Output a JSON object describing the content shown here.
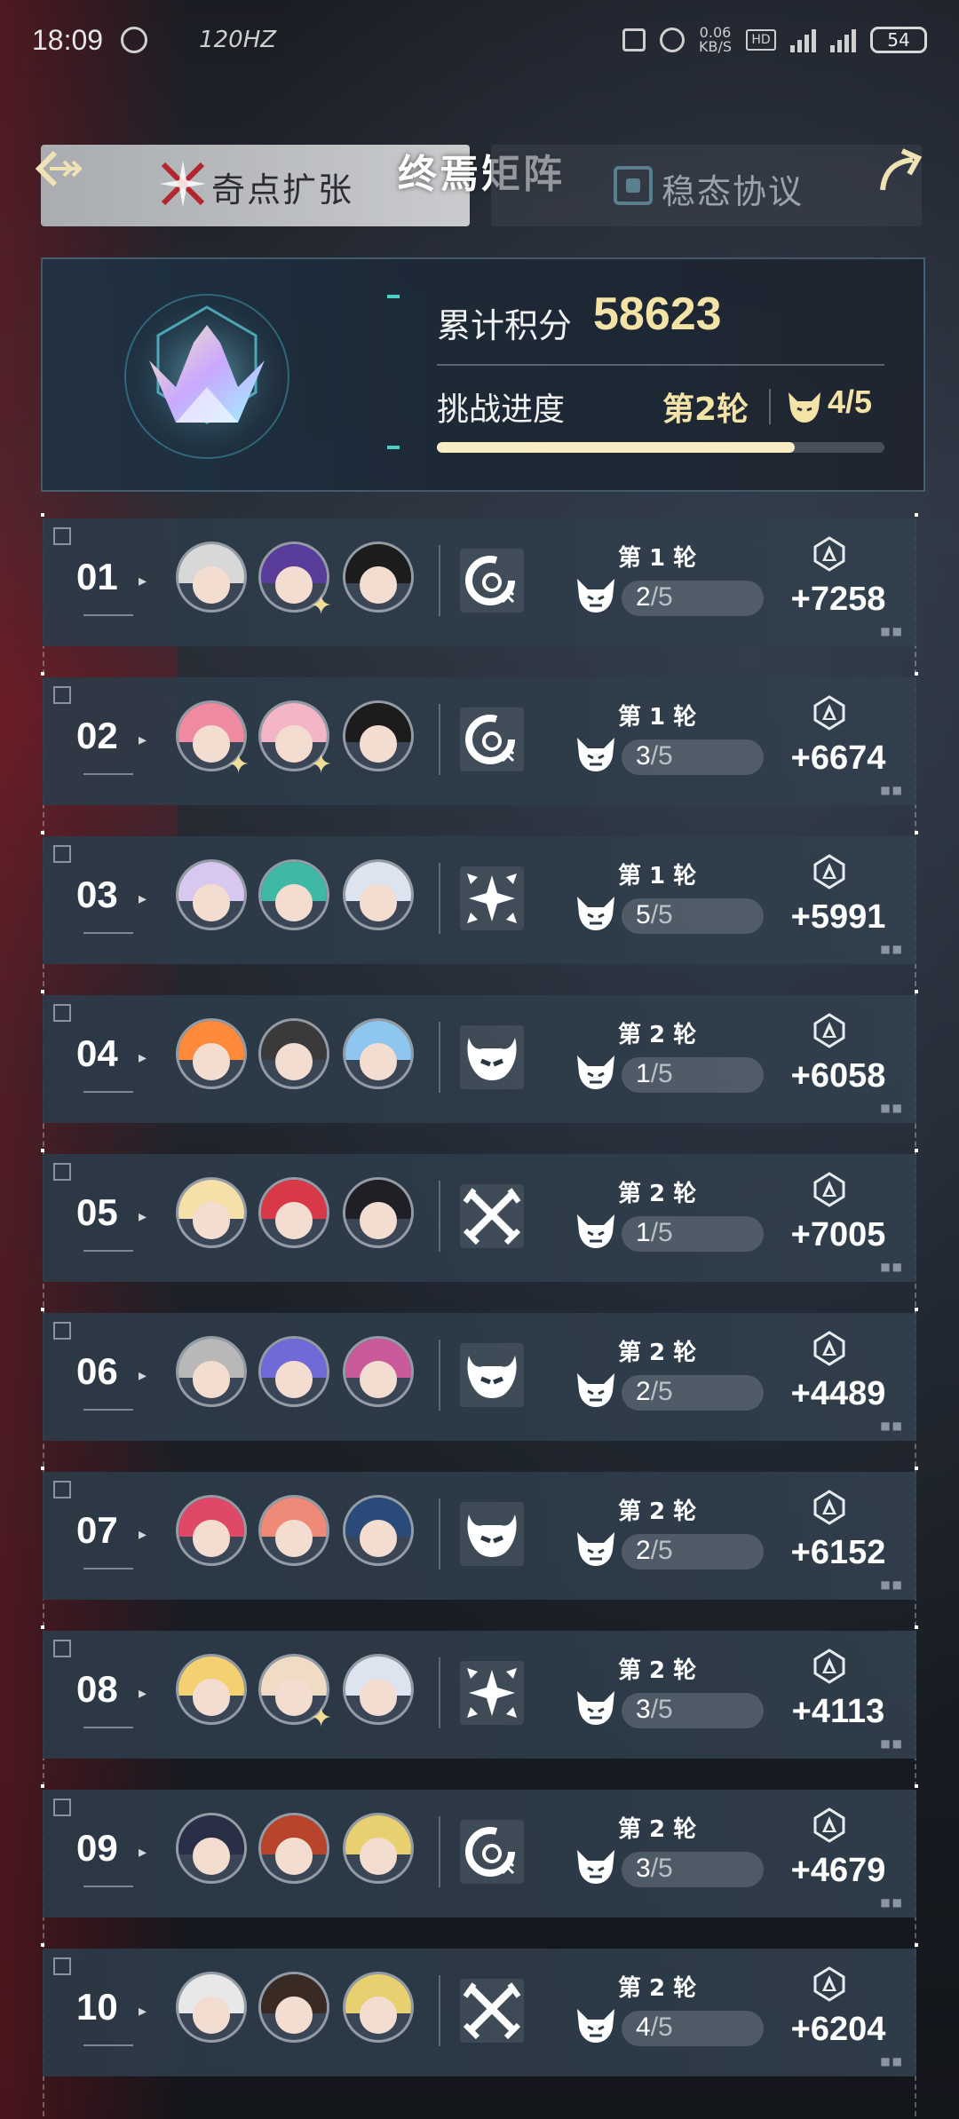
{
  "status_bar": {
    "time": "18:09",
    "refresh_rate": "120",
    "net_speed_value": "0.06",
    "net_speed_unit": "KB/S",
    "battery": "54"
  },
  "header": {
    "back_icon": "back-arrow-icon",
    "left_tab_label": "奇点扩张",
    "title": "终焉矩阵",
    "right_tab_label": "稳态协议",
    "share_icon": "share-arrow-icon"
  },
  "summary": {
    "score_label": "累计积分",
    "score_value": "58623",
    "progress_label": "挑战进度",
    "round_label": "第2轮",
    "stage": "4/5",
    "progress_fraction": 0.8
  },
  "rows": [
    {
      "num": "01",
      "round": "第 1 轮",
      "stage_num": "2",
      "stage_den": "/5",
      "score": "+7258",
      "mode": "spiral"
    },
    {
      "num": "02",
      "round": "第 1 轮",
      "stage_num": "3",
      "stage_den": "/5",
      "score": "+6674",
      "mode": "spiral"
    },
    {
      "num": "03",
      "round": "第 1 轮",
      "stage_num": "5",
      "stage_den": "/5",
      "score": "+5991",
      "mode": "burst"
    },
    {
      "num": "04",
      "round": "第 2 轮",
      "stage_num": "1",
      "stage_den": "/5",
      "score": "+6058",
      "mode": "devil"
    },
    {
      "num": "05",
      "round": "第 2 轮",
      "stage_num": "1",
      "stage_den": "/5",
      "score": "+7005",
      "mode": "swords"
    },
    {
      "num": "06",
      "round": "第 2 轮",
      "stage_num": "2",
      "stage_den": "/5",
      "score": "+4489",
      "mode": "devil"
    },
    {
      "num": "07",
      "round": "第 2 轮",
      "stage_num": "2",
      "stage_den": "/5",
      "score": "+6152",
      "mode": "devil"
    },
    {
      "num": "08",
      "round": "第 2 轮",
      "stage_num": "3",
      "stage_den": "/5",
      "score": "+4113",
      "mode": "burst"
    },
    {
      "num": "09",
      "round": "第 2 轮",
      "stage_num": "3",
      "stage_den": "/5",
      "score": "+4679",
      "mode": "spiral"
    },
    {
      "num": "10",
      "round": "第 2 轮",
      "stage_num": "4",
      "stage_den": "/5",
      "score": "+6204",
      "mode": "swords"
    }
  ],
  "colors": {
    "accent_gold": "#f4e3a6",
    "row_bg": "#2c3a48",
    "panel_bg": "#1e3446"
  }
}
